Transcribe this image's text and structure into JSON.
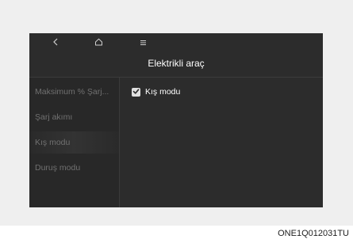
{
  "nav": {
    "back_icon": "chevron-left-icon",
    "home_icon": "home-icon",
    "menu_icon": "menu-icon"
  },
  "screen": {
    "title": "Elektrikli araç"
  },
  "sidebar": {
    "items": [
      {
        "label": "Maksimum % Şarj..."
      },
      {
        "label": "Şarj akımı"
      },
      {
        "label": "Kış modu",
        "selected": true
      },
      {
        "label": "Duruş modu"
      }
    ]
  },
  "content": {
    "option_label": "Kış modu",
    "option_checked": true
  },
  "caption": "ONE1Q012031TU",
  "colors": {
    "screen_bg": "#2c2c2c",
    "sidebar_bg": "#282828",
    "text_primary": "#ffffff",
    "text_muted": "#707070"
  }
}
